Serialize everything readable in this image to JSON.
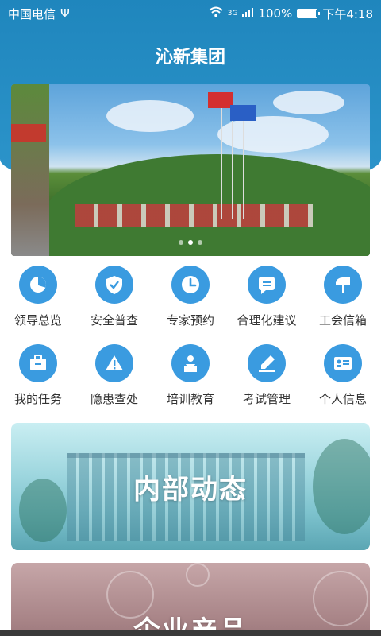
{
  "status_bar": {
    "carrier": "中国电信",
    "network": "3G",
    "battery": "100%",
    "time": "下午4:18"
  },
  "header": {
    "title": "沁新集团"
  },
  "banner": {
    "slide_count": 3,
    "active_slide": 1
  },
  "menu": [
    {
      "label": "领导总览",
      "icon": "pie-chart-icon"
    },
    {
      "label": "安全普查",
      "icon": "shield-check-icon"
    },
    {
      "label": "专家预约",
      "icon": "clock-icon"
    },
    {
      "label": "合理化建议",
      "icon": "chat-bubble-icon"
    },
    {
      "label": "工会信箱",
      "icon": "mailbox-icon"
    },
    {
      "label": "我的任务",
      "icon": "briefcase-icon"
    },
    {
      "label": "隐患查处",
      "icon": "warning-icon"
    },
    {
      "label": "培训教育",
      "icon": "lecturer-icon"
    },
    {
      "label": "考试管理",
      "icon": "pen-edit-icon"
    },
    {
      "label": "个人信息",
      "icon": "id-card-icon"
    }
  ],
  "cards": [
    {
      "label": "内部动态"
    },
    {
      "label": "企业产品"
    }
  ],
  "colors": {
    "header_blue": "#1f86bd",
    "icon_blue": "#3a9be0",
    "card_teal": "#7ec3ce",
    "card_mauve": "#a88487"
  }
}
